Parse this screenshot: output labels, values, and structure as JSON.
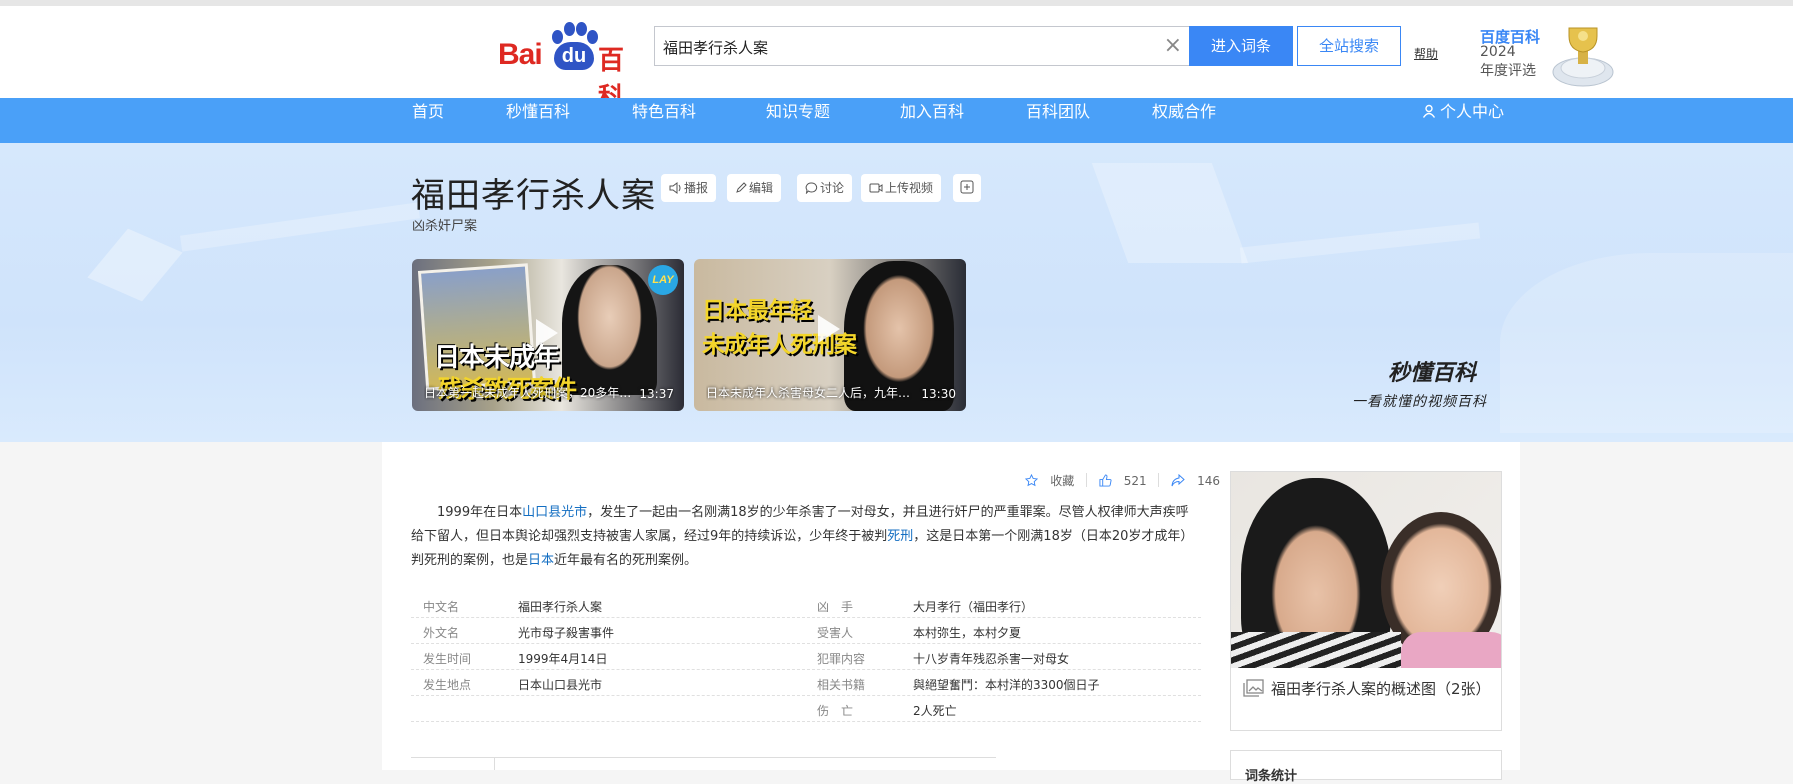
{
  "header": {
    "logo_bai": "Bai",
    "logo_du": "du",
    "logo_baike": "百科",
    "search_value": "福田孝行杀人案",
    "enter_label": "进入词条",
    "all_site_label": "全站搜索",
    "help_label": "帮助",
    "award_line1": "百度百科",
    "award_line2": "2024",
    "award_line3": "年度评选"
  },
  "nav": {
    "items": [
      "首页",
      "秒懂百科",
      "特色百科",
      "知识专题",
      "加入百科",
      "百科团队",
      "权威合作"
    ],
    "personal": "个人中心"
  },
  "entry": {
    "title": "福田孝行杀人案",
    "subtitle": "凶杀奸尸案",
    "tools": {
      "broadcast": "播报",
      "edit": "编辑",
      "discuss": "讨论",
      "upload_video": "上传视频"
    }
  },
  "videos": [
    {
      "overlay_line1": "日本未成年",
      "overlay_line2": "残杀致死案件",
      "caption": "日本第一起未成年人死刑案，20多年…",
      "duration": "13:37",
      "badge": "LAY"
    },
    {
      "overlay_line1": "日本最年轻",
      "overlay_line2": "未成年人死刑案",
      "caption": "日本未成年人杀害母女二人后，九年…",
      "duration": "13:30"
    }
  ],
  "miaodong": {
    "logo": "秒懂百科",
    "slogan": "一看就懂的视频百科"
  },
  "stats": {
    "favorite_label": "收藏",
    "likes": "521",
    "shares": "146"
  },
  "summary": {
    "p1": "1999年在日本",
    "link1": "山口县光市",
    "p2": "，发生了一起由一名刚满18岁的少年杀害了一对母女，并且进行奸尸的严重罪案。尽管人权律师大声疾呼给下留人，但日本舆论却强烈支持被害人家属，经过9年的持续诉讼，少年终于被判",
    "link2": "死刑",
    "p3": "，这是日本第一个刚满18岁（日本20岁才成年）判死刑的案例，也是",
    "link3": "日本",
    "p4": "近年最有名的死刑案例。"
  },
  "infobox": {
    "left": [
      {
        "label": "中文名",
        "value": "福田孝行杀人案"
      },
      {
        "label": "外文名",
        "value": "光市母子殺害事件"
      },
      {
        "label": "发生时间",
        "value": "1999年4月14日"
      },
      {
        "label": "发生地点",
        "value": "日本山口县光市"
      }
    ],
    "right": [
      {
        "label": "凶　手",
        "value": "大月孝行（福田孝行）"
      },
      {
        "label": "受害人",
        "value": "本村弥生，本村夕夏"
      },
      {
        "label": "犯罪内容",
        "value": "十八岁青年残忍杀害一对母女"
      },
      {
        "label": "相关书籍",
        "value": "與絕望奮鬥：本村洋的3300個日子"
      },
      {
        "label": "伤　亡",
        "value": "2人死亡"
      }
    ]
  },
  "album": {
    "caption": "福田孝行杀人案的概述图（2张）"
  },
  "related": {
    "title": "词条统计"
  },
  "colors": {
    "brand_blue": "#4aa0f8",
    "button_blue": "#3a87f5",
    "link": "#136ec2",
    "logo_red": "#de2922"
  }
}
